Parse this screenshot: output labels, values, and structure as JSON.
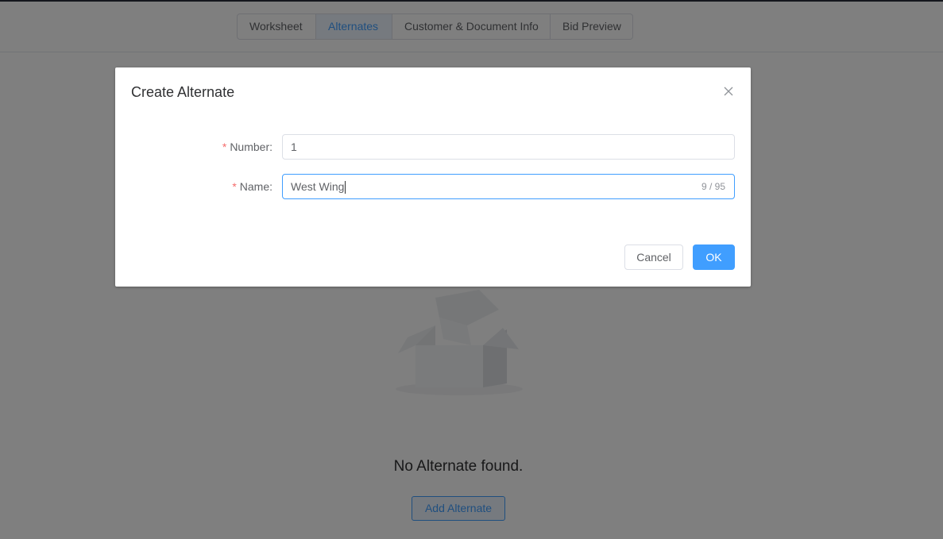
{
  "tabs": [
    {
      "label": "Worksheet",
      "active": false
    },
    {
      "label": "Alternates",
      "active": true
    },
    {
      "label": "Customer & Document Info",
      "active": false
    },
    {
      "label": "Bid Preview",
      "active": false
    }
  ],
  "empty_state": {
    "message": "No Alternate found.",
    "illustration": "empty-box-icon",
    "add_button_label": "Add Alternate"
  },
  "dialog": {
    "title": "Create Alternate",
    "close_icon": "close-icon",
    "required_marker": "*",
    "fields": {
      "number": {
        "label": "Number:",
        "value": "1"
      },
      "name": {
        "label": "Name:",
        "value": "West Wing",
        "counter": "9 / 95"
      }
    },
    "cancel_label": "Cancel",
    "ok_label": "OK"
  },
  "colors": {
    "primary": "#409eff",
    "required": "#f56c6c",
    "overlay": "rgba(0,0,0,0.5)"
  }
}
